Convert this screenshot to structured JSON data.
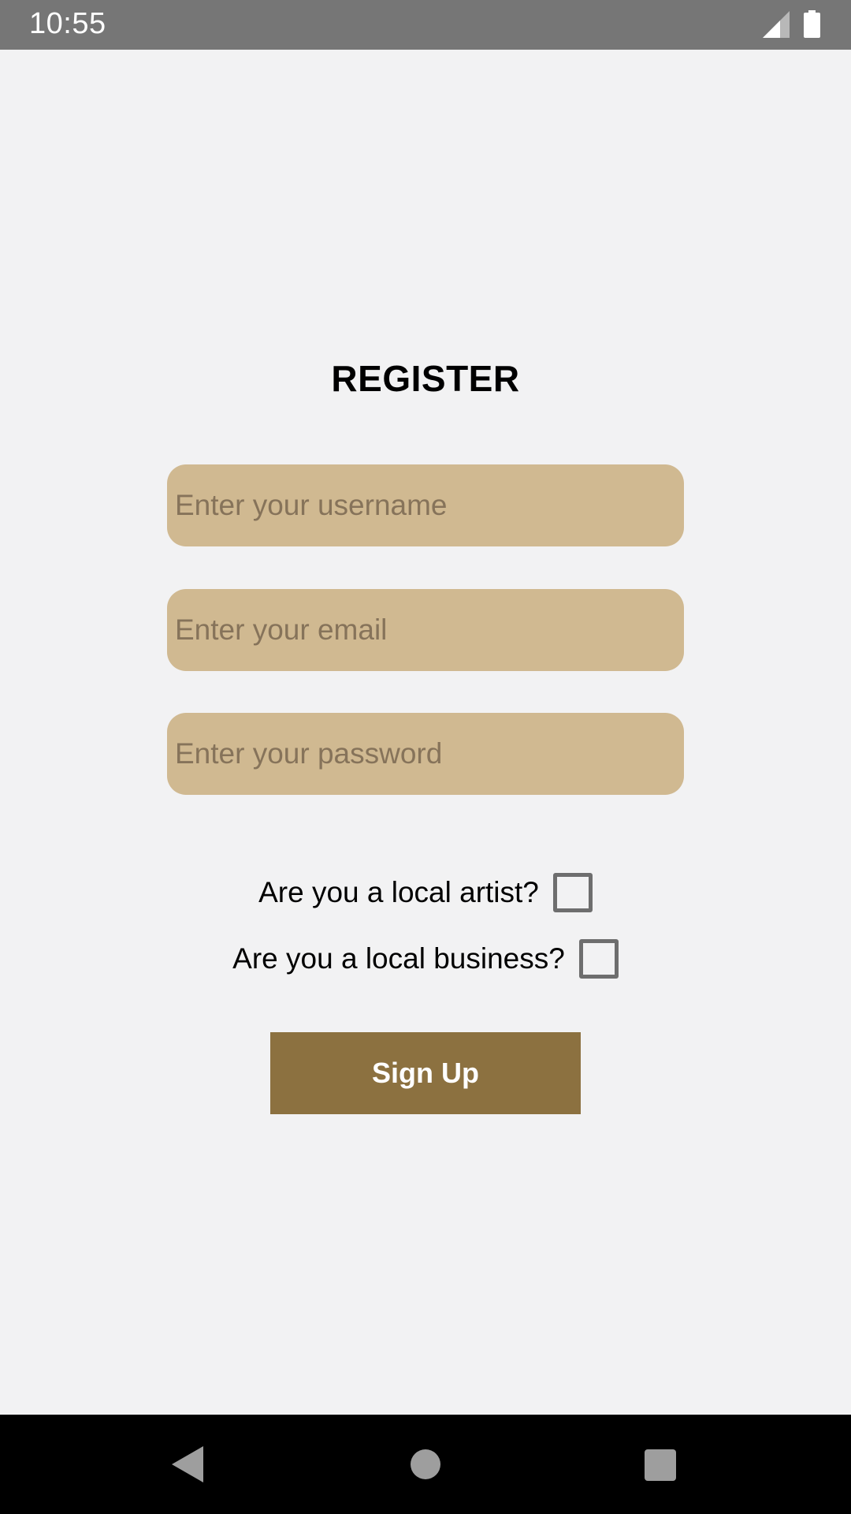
{
  "status_bar": {
    "time": "10:55",
    "icons": [
      "signal-icon",
      "battery-icon"
    ]
  },
  "form": {
    "title": "REGISTER",
    "username_placeholder": "Enter your username",
    "email_placeholder": "Enter your email",
    "password_placeholder": "Enter your password",
    "artist_question": "Are you a local artist?",
    "artist_checked": false,
    "business_question": "Are you a local business?",
    "business_checked": false,
    "signup_label": "Sign Up"
  },
  "nav_bar": {
    "icons": [
      "back-icon",
      "home-icon",
      "recents-icon"
    ]
  },
  "colors": {
    "background": "#f2f2f3",
    "status_bar": "#767676",
    "field_fill": "#d0b991",
    "placeholder_text": "#86735a",
    "button_fill": "#8c7140",
    "nav_bar": "#000000"
  }
}
